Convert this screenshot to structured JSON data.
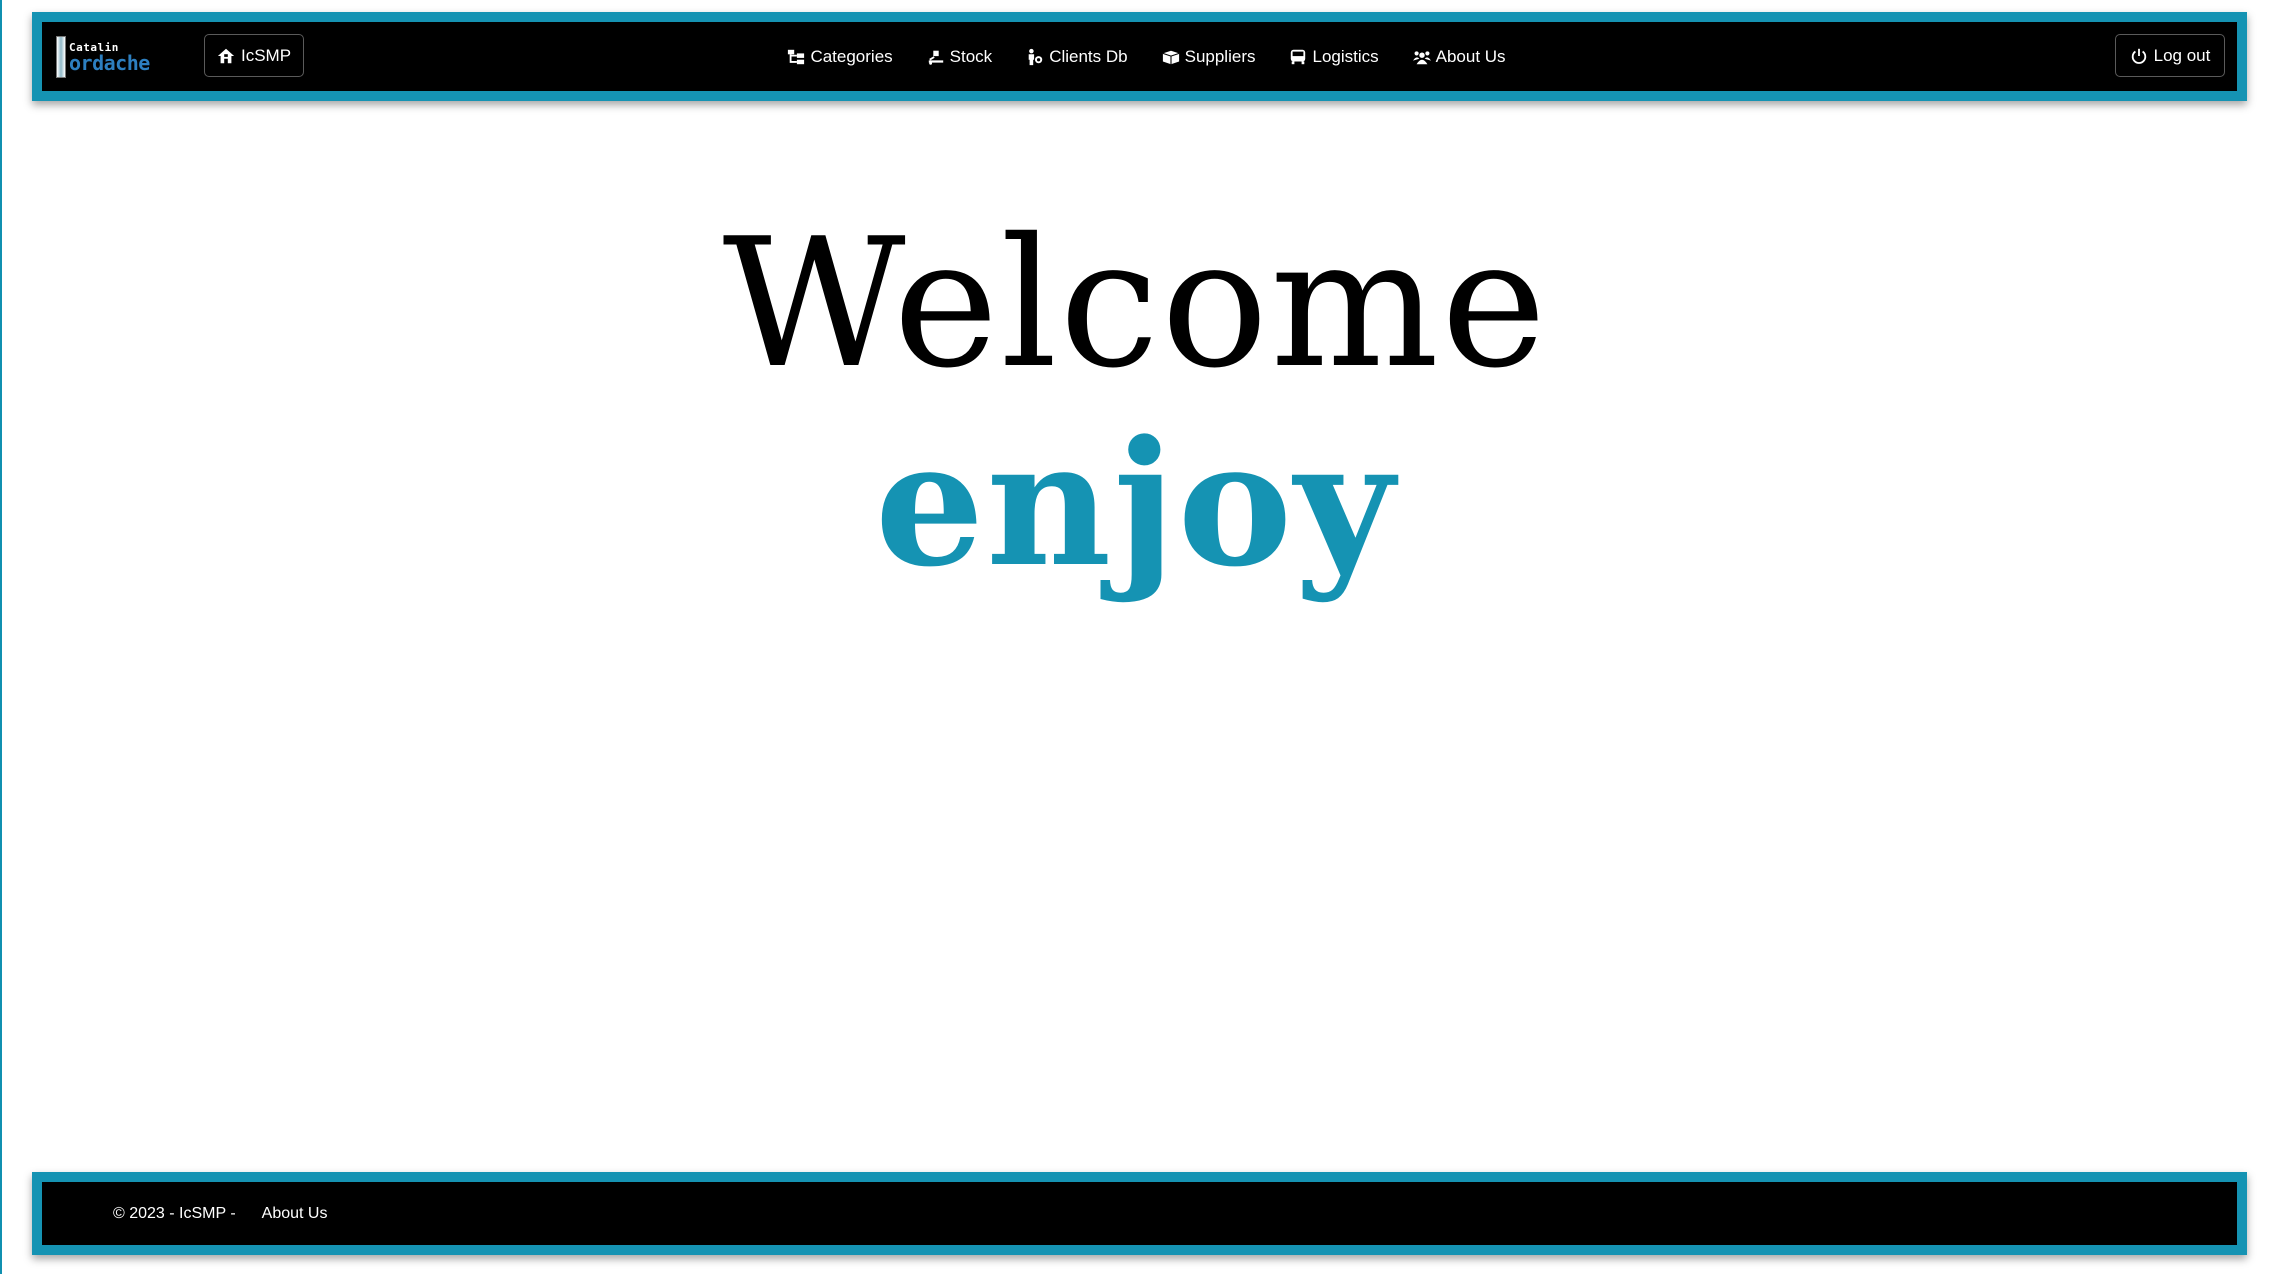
{
  "colors": {
    "accent": "#1593b3",
    "bar_background": "#000000",
    "welcome_text": "#000000",
    "enjoy_text": "#1593b3"
  },
  "brand": {
    "small_text": "Catalin",
    "big_text": "ordache"
  },
  "navbar": {
    "home_label": "IcSMP",
    "home_icon": "home-icon",
    "links": [
      {
        "label": "Categories",
        "icon": "sitemap-icon"
      },
      {
        "label": "Stock",
        "icon": "dolly-icon"
      },
      {
        "label": "Clients Db",
        "icon": "person-icon"
      },
      {
        "label": "Suppliers",
        "icon": "box-icon"
      },
      {
        "label": "Logistics",
        "icon": "truck-icon"
      },
      {
        "label": "About Us",
        "icon": "users-icon"
      }
    ],
    "logout_label": "Log out",
    "logout_icon": "power-icon"
  },
  "main": {
    "heading": "Welcome",
    "subheading": "enjoy"
  },
  "footer": {
    "copyright": "© 2023 - IcSMP -",
    "about_label": "About Us"
  }
}
